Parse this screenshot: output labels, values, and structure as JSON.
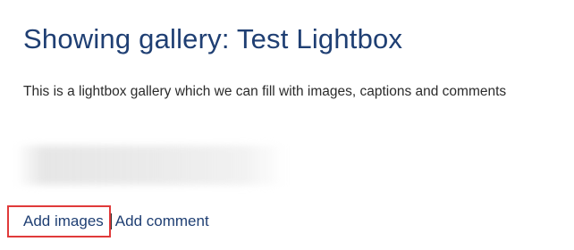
{
  "page": {
    "title": "Showing gallery: Test Lightbox",
    "description": "This is a lightbox gallery which we can fill with images, captions and comments"
  },
  "actions": {
    "add_images_label": "Add images",
    "add_comment_label": "Add comment"
  },
  "colors": {
    "title": "#1f3f73",
    "link": "#1f3f73",
    "highlight_border": "#e03a3a",
    "body_text": "#2b2b2b"
  }
}
